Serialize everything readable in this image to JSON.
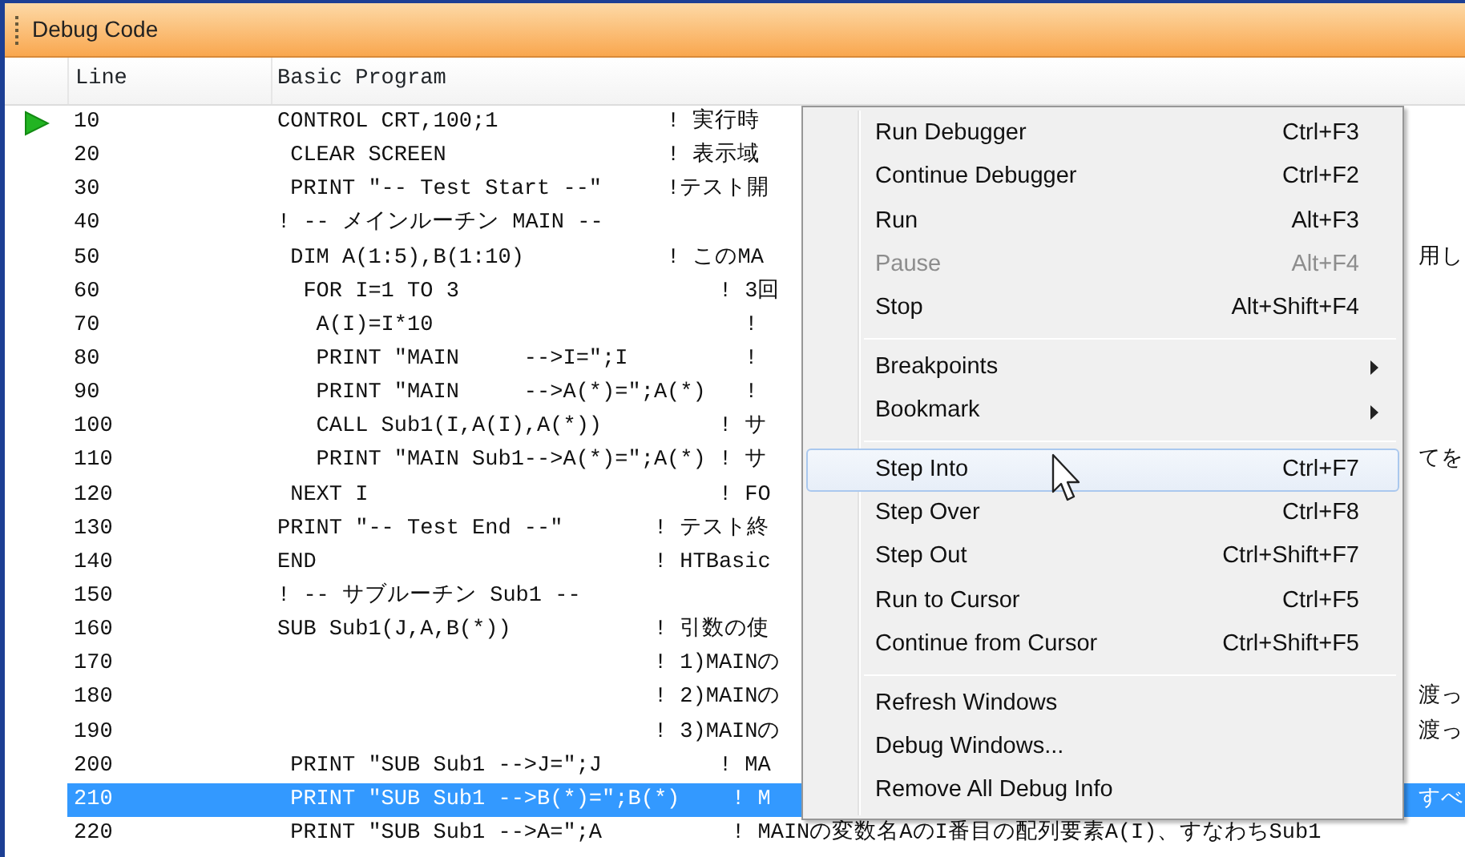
{
  "window": {
    "title": "Debug Code"
  },
  "columns": [
    "Line",
    "Basic Program"
  ],
  "rows": [
    {
      "line": "10",
      "code": "CONTROL CRT,100;1             ! 実行時",
      "current": true,
      "selected": false
    },
    {
      "line": "20",
      "code": " CLEAR SCREEN                 ! 表示域",
      "current": false,
      "selected": false
    },
    {
      "line": "30",
      "code": " PRINT \"-- Test Start --\"     !テスト開",
      "current": false,
      "selected": false
    },
    {
      "line": "40",
      "code": "! -- メインルーチン MAIN --",
      "current": false,
      "selected": false
    },
    {
      "line": "50",
      "code": " DIM A(1:5),B(1:10)           ! このMA",
      "right_text": "用し",
      "current": false,
      "selected": false
    },
    {
      "line": "60",
      "code": "  FOR I=1 TO 3                    ! 3回",
      "current": false,
      "selected": false
    },
    {
      "line": "70",
      "code": "   A(I)=I*10                        !",
      "current": false,
      "selected": false
    },
    {
      "line": "80",
      "code": "   PRINT \"MAIN     -->I=\";I         !",
      "current": false,
      "selected": false
    },
    {
      "line": "90",
      "code": "   PRINT \"MAIN     -->A(*)=\";A(*)   !",
      "current": false,
      "selected": false
    },
    {
      "line": "100",
      "code": "   CALL Sub1(I,A(I),A(*))         ! サ",
      "current": false,
      "selected": false
    },
    {
      "line": "110",
      "code": "   PRINT \"MAIN Sub1-->A(*)=\";A(*) ! サ",
      "right_text": "てを",
      "current": false,
      "selected": false
    },
    {
      "line": "120",
      "code": " NEXT I                           ! FO",
      "current": false,
      "selected": false
    },
    {
      "line": "130",
      "code": "PRINT \"-- Test End --\"       ! テスト終",
      "current": false,
      "selected": false
    },
    {
      "line": "140",
      "code": "END                          ! HTBasic",
      "current": false,
      "selected": false
    },
    {
      "line": "150",
      "code": "! -- サブルーチン Sub1 --",
      "current": false,
      "selected": false
    },
    {
      "line": "160",
      "code": "SUB Sub1(J,A,B(*))           ! 引数の使",
      "current": false,
      "selected": false
    },
    {
      "line": "170",
      "code": "                             ! 1)MAINの",
      "current": false,
      "selected": false
    },
    {
      "line": "180",
      "code": "                             ! 2)MAINの",
      "right_text": "渡っ",
      "current": false,
      "selected": false
    },
    {
      "line": "190",
      "code": "                             ! 3)MAINの",
      "right_text": "渡っ",
      "current": false,
      "selected": false
    },
    {
      "line": "200",
      "code": " PRINT \"SUB Sub1 -->J=\";J         ! MA",
      "current": false,
      "selected": false
    },
    {
      "line": "210",
      "code": " PRINT \"SUB Sub1 -->B(*)=\";B(*)    ! M",
      "right_text": "すべ",
      "current": false,
      "selected": true
    },
    {
      "line": "220",
      "code": " PRINT \"SUB Sub1 -->A=\";A          ! MAINの変数名AのI番目の配列要素A(I)、すなわちSub1",
      "current": false,
      "selected": false
    }
  ],
  "context_menu": {
    "groups": [
      [
        {
          "label": "Run Debugger",
          "shortcut": "Ctrl+F3",
          "disabled": false,
          "selected": false,
          "submenu": false
        },
        {
          "label": "Continue Debugger",
          "shortcut": "Ctrl+F2",
          "disabled": false,
          "selected": false,
          "submenu": false
        },
        {
          "label": "Run",
          "shortcut": "Alt+F3",
          "disabled": false,
          "selected": false,
          "submenu": false
        },
        {
          "label": "Pause",
          "shortcut": "Alt+F4",
          "disabled": true,
          "selected": false,
          "submenu": false
        },
        {
          "label": "Stop",
          "shortcut": "Alt+Shift+F4",
          "disabled": false,
          "selected": false,
          "submenu": false
        }
      ],
      [
        {
          "label": "Breakpoints",
          "disabled": false,
          "selected": false,
          "submenu": true
        },
        {
          "label": "Bookmark",
          "disabled": false,
          "selected": false,
          "submenu": true
        }
      ],
      [
        {
          "label": "Step Into",
          "shortcut": "Ctrl+F7",
          "disabled": false,
          "selected": true,
          "submenu": false
        },
        {
          "label": "Step Over",
          "shortcut": "Ctrl+F8",
          "disabled": false,
          "selected": false,
          "submenu": false
        },
        {
          "label": "Step Out",
          "shortcut": "Ctrl+Shift+F7",
          "disabled": false,
          "selected": false,
          "submenu": false
        },
        {
          "label": "Run to Cursor",
          "shortcut": "Ctrl+F5",
          "disabled": false,
          "selected": false,
          "submenu": false
        },
        {
          "label": "Continue from Cursor",
          "shortcut": "Ctrl+Shift+F5",
          "disabled": false,
          "selected": false,
          "submenu": false
        }
      ],
      [
        {
          "label": "Refresh Windows",
          "disabled": false,
          "selected": false,
          "submenu": false
        },
        {
          "label": "Debug Windows...",
          "disabled": false,
          "selected": false,
          "submenu": false
        },
        {
          "label": "Remove All Debug Info",
          "disabled": false,
          "selected": false,
          "submenu": false
        }
      ]
    ]
  }
}
